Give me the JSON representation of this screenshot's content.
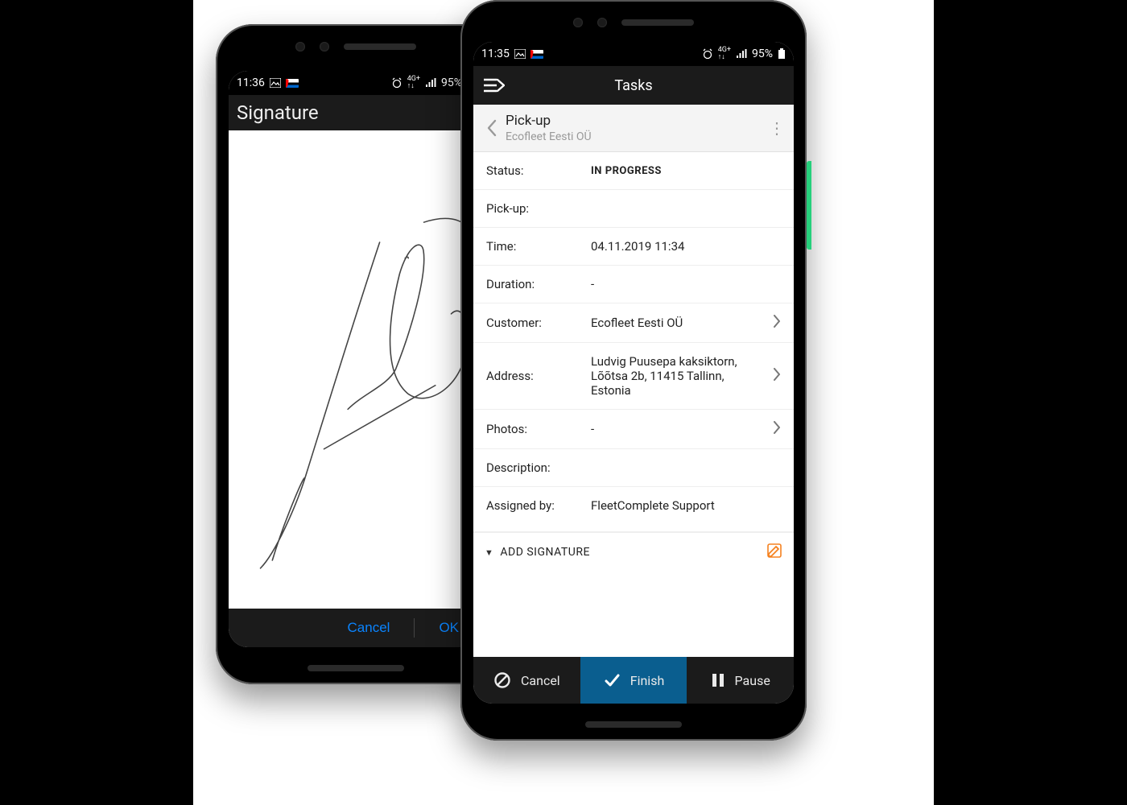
{
  "phoneA": {
    "statusbar": {
      "time": "11:36",
      "battery": "95%"
    },
    "titlebar": "Signature",
    "actions": {
      "cancel": "Cancel",
      "ok": "OK"
    }
  },
  "phoneB": {
    "statusbar": {
      "time": "11:35",
      "battery": "95%"
    },
    "appbar_title": "Tasks",
    "subheader": {
      "title": "Pick-up",
      "subtitle": "Ecofleet Eesti OÜ"
    },
    "rows": {
      "status_label": "Status:",
      "status_value": "IN PROGRESS",
      "pickup_label": "Pick-up:",
      "time_label": "Time:",
      "time_value": "04.11.2019 11:34",
      "duration_label": "Duration:",
      "duration_value": "-",
      "customer_label": "Customer:",
      "customer_value": "Ecofleet Eesti OÜ",
      "address_label": "Address:",
      "address_value": "Ludvig Puusepa kaksiktorn, Lõõtsa 2b, 11415 Tallinn, Estonia",
      "photos_label": "Photos:",
      "photos_value": "-",
      "description_label": "Description:",
      "assigned_label": "Assigned by:",
      "assigned_value": "FleetComplete Support"
    },
    "add_signature": "ADD SIGNATURE",
    "footer": {
      "cancel": "Cancel",
      "finish": "Finish",
      "pause": "Pause"
    }
  }
}
